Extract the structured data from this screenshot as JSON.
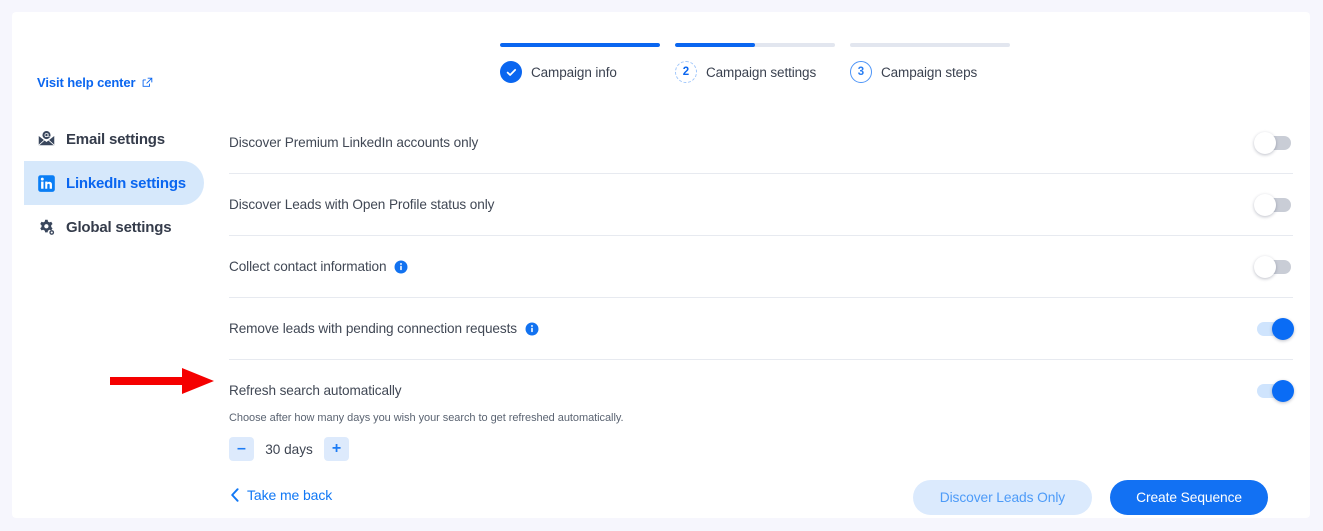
{
  "window": {
    "background_color": "#f6f6fd",
    "card_color": "#ffffff",
    "accent_color": "#0a66f0"
  },
  "stepper": {
    "steps": [
      {
        "badge": "check-icon",
        "label": "Campaign info",
        "state": "done",
        "progress_percent": 100
      },
      {
        "badge": "2",
        "label": "Campaign settings",
        "state": "current",
        "progress_percent": 50
      },
      {
        "badge": "3",
        "label": "Campaign steps",
        "state": "todo",
        "progress_percent": 0
      }
    ]
  },
  "sidebar": {
    "help_link": {
      "label": "Visit help center",
      "icon": "external-link-icon"
    },
    "items": [
      {
        "label": "Email settings",
        "icon": "email-icon",
        "active": false
      },
      {
        "label": "LinkedIn settings",
        "icon": "linkedin-icon",
        "active": true
      },
      {
        "label": "Global settings",
        "icon": "gear-icon",
        "active": false
      }
    ]
  },
  "settings_rows": [
    {
      "label": "Discover Premium LinkedIn accounts only",
      "info": false,
      "toggle": "off"
    },
    {
      "label": "Discover Leads with Open Profile status only",
      "info": false,
      "toggle": "off"
    },
    {
      "label": "Collect contact information",
      "info": true,
      "toggle": "off"
    },
    {
      "label": "Remove leads with pending connection requests",
      "info": true,
      "toggle": "on"
    },
    {
      "label": "Refresh search automatically",
      "info": false,
      "toggle": "on"
    }
  ],
  "refresh_detail": {
    "hint": "Choose after how many days you wish your search to get refreshed automatically.",
    "decrement_label": "–",
    "value": "30 days",
    "increment_label": "+"
  },
  "footer": {
    "back_label": "Take me back",
    "secondary_button": "Discover Leads Only",
    "primary_button": "Create Sequence"
  },
  "annotation": {
    "arrow_color": "#f50000",
    "points_to": "Refresh search automatically"
  }
}
